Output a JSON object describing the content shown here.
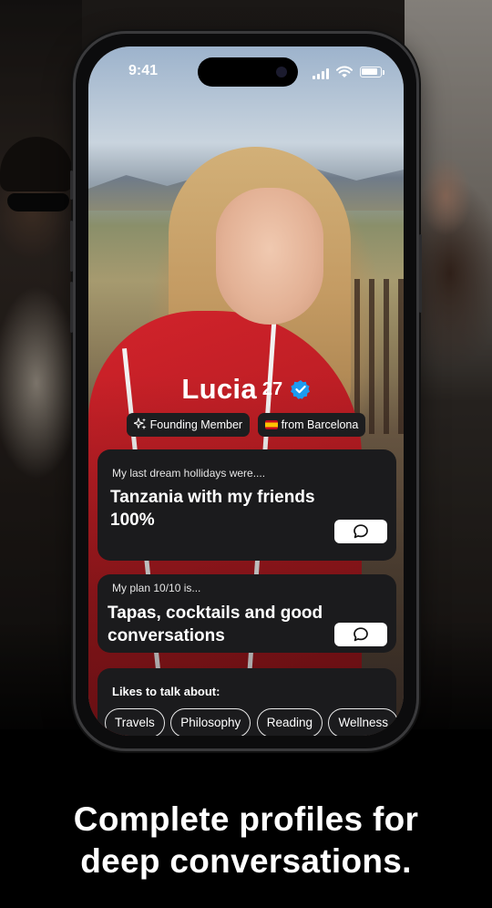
{
  "status_bar": {
    "time": "9:41"
  },
  "profile": {
    "name": "Lucia",
    "age": "27",
    "badges": [
      {
        "label": "Founding Member",
        "icon": "sparkles-icon"
      },
      {
        "label": "from Barcelona",
        "icon": "spain-flag-icon"
      }
    ]
  },
  "prompts": [
    {
      "question": "My last dream hollidays were....",
      "answer": "Tanzania with my friends 100%"
    },
    {
      "question": "My plan 10/10 is...",
      "answer": "Tapas, cocktails and good conversations"
    }
  ],
  "likes": {
    "title": "Likes to talk about:",
    "tags": [
      "Travels",
      "Philosophy",
      "Reading",
      "Wellness"
    ]
  },
  "headline": {
    "line1": "Complete profiles for",
    "line2": "deep conversations."
  },
  "colors": {
    "card_bg": "#1b1b1d",
    "verified_blue": "#1d9bf0",
    "jacket_red": "#c41f26"
  }
}
